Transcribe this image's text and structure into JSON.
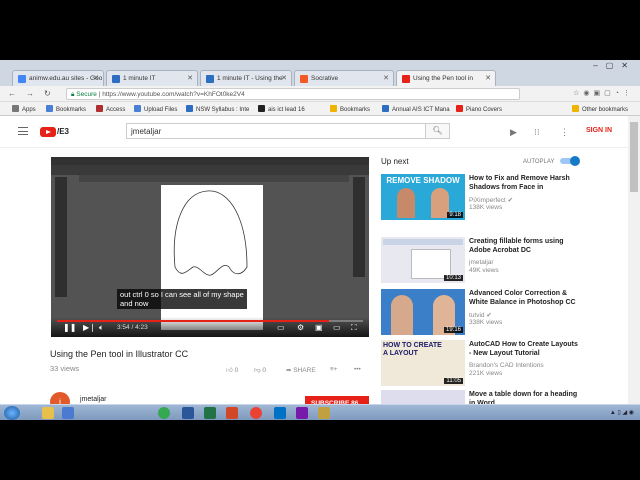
{
  "browser": {
    "tabs": [
      {
        "label": "animw.edu.au sites - Goo",
        "icon_color": "#4285f4",
        "active": false
      },
      {
        "label": "1 minute IT",
        "icon_color": "#2e6ec2",
        "active": false
      },
      {
        "label": "1 minute IT - Using the",
        "icon_color": "#2e6ec2",
        "active": false
      },
      {
        "label": "Socrative",
        "icon_color": "#f15a24",
        "active": false
      },
      {
        "label": "Using the Pen tool in",
        "icon_color": "#e62117",
        "active": true
      }
    ],
    "address": {
      "secure_label": "Secure",
      "url": "https://www.youtube.com/watch?v=KhFOt0ke2V4"
    },
    "bookmarks": [
      {
        "label": "Apps",
        "icon_color": "#777"
      },
      {
        "label": "Bookmarks",
        "icon_color": "#4a7fd6"
      },
      {
        "label": "Access",
        "icon_color": "#b03030"
      },
      {
        "label": "Upload Files",
        "icon_color": "#4a7fd6"
      },
      {
        "label": "NSW Syllabus : Inte",
        "icon_color": "#2e6ec2"
      },
      {
        "label": "ais ict lead 16",
        "icon_color": "#222"
      },
      {
        "label": "Bookmarks",
        "icon_color": "#f0b400"
      },
      {
        "label": "Annual AIS ICT Mana",
        "icon_color": "#2e6ec2"
      },
      {
        "label": "Piano Covers",
        "icon_color": "#e62117"
      }
    ],
    "other_bookmarks": "Other bookmarks"
  },
  "youtube": {
    "logo_suffix": "/E3",
    "search_value": "jmetaljar",
    "sign_in": "SIGN IN",
    "video": {
      "caption_lines": [
        "out ctrl 0 so I can see all of my shape",
        "and now"
      ],
      "time": "3:54 / 4:23",
      "progress": 0.89,
      "title": "Using the Pen tool in Illustrator CC",
      "views": "33 views",
      "likes": "0",
      "dislikes": "0",
      "share": "SHARE",
      "channel_initial": "j",
      "channel": "jmetaljar",
      "subscribe": "SUBSCRIBE  86"
    },
    "up_next": {
      "heading": "Up next",
      "autoplay": "AUTOPLAY",
      "items": [
        {
          "title": "How to Fix and Remove Harsh Shadows from Face in",
          "channel": "PiXimperfect",
          "views": "138K views",
          "duration": "9:18",
          "thumb_text": "REMOVE SHADOW",
          "thumb_color": "#2aa8d8"
        },
        {
          "title": "Creating fillable forms using Adobe Acrobat DC",
          "channel": "jmetaljar",
          "views": "49K views",
          "duration": "10:13",
          "thumb_text": "",
          "thumb_color": "#e8e8f0"
        },
        {
          "title": "Advanced Color Correction & White Balance in Photoshop CC",
          "channel": "tutvid",
          "views": "338K views",
          "duration": "19:16",
          "thumb_text": "",
          "thumb_color": "#3a7fc8"
        },
        {
          "title": "AutoCAD How to Create Layouts - New Layout Tutorial",
          "channel": "Brandon's CAD Intentions",
          "views": "221K views",
          "duration": "11:05",
          "thumb_text": "HOW TO CREATE A LAYOUT",
          "thumb_color": "#f0e8d8"
        },
        {
          "title": "Move a table down for a heading in Word",
          "channel": "",
          "views": "",
          "duration": "",
          "thumb_text": "",
          "thumb_color": "#dde"
        }
      ]
    }
  },
  "taskbar": {
    "icons": [
      {
        "name": "explorer",
        "color": "#e6c04a"
      },
      {
        "name": "media",
        "color": "#4b7bd1"
      },
      {
        "name": "chrome",
        "color": "#34a853"
      },
      {
        "name": "word",
        "color": "#2b579a"
      },
      {
        "name": "excel",
        "color": "#217346"
      },
      {
        "name": "powerpoint",
        "color": "#d24726"
      },
      {
        "name": "chrome2",
        "color": "#ea4335"
      },
      {
        "name": "outlook",
        "color": "#0072c6"
      },
      {
        "name": "onenote",
        "color": "#7719aa"
      },
      {
        "name": "app",
        "color": "#c0a040"
      }
    ]
  }
}
